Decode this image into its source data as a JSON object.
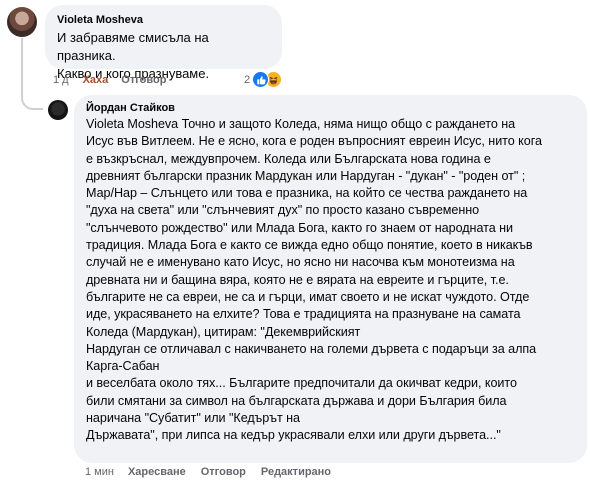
{
  "comments": [
    {
      "author": "Violeta Mosheva",
      "lines": [
        "И забравяме смисъла на празника.",
        "Какво и кого празнуваме."
      ],
      "time": "1 д",
      "like_label": "Хаха",
      "reply_label": "Отговор",
      "reaction_count": "2"
    },
    {
      "author": "Йордан Стайков",
      "lines": [
        "Violeta Mosheva Точно и защото Коледа, няма нищо общо с раждането на",
        "Исус във Витлеем. Не е ясно, кога е роден въпросният евреин Исус, нито кога",
        "е възкръснал, междувпрочем. Коледа или Българската нова година е",
        "древният български празник Мардукан или Нардуган - \"дукан\" - \"роден от\" ;",
        "Мар/Нар – Слънцето или това е празника, на който се чества раждането на",
        "\"духа на света\" или \"слънчевият дух\" по просто казано съвременно",
        "\"слънчевото рождество\" или Млада Бога, както го знаем от народната ни",
        "традиция. Млада Бога е както се вижда едно общо понятие, което в никакъв",
        "случай не е именувано като Исус, но ясно ни насочва към монотеизма на",
        "древната ни и бащина вяра, която не е вярата на евреите и гърците, т.е.",
        "българите не са евреи, не са и гърци, имат своето и не искат чуждото. Отде",
        "иде, украсяването на елхите? Това е традицията на празнуване на самата",
        "Коледа (Мардукан), цитирам: \"Декемврийският",
        "Нардуган се отличавал с накичването на големи дървета с подаръци за алпа",
        "Карга-Сабан",
        "и веселбата около тях... Българите предпочитали да окичват кедри, които",
        "били смятани за символ на българската държава и дори България била",
        "наричана \"Субатит\" или \"Кедърът на",
        "Държавата\", при липса на кедър украсявали елхи или други дървета...\""
      ],
      "time": "1 мин",
      "like_label": "Харесване",
      "reply_label": "Отговор",
      "edit_label": "Редактирано"
    }
  ],
  "icons": {
    "reaction_like": "thumbs-up-icon",
    "reaction_haha": "laughing-face-icon"
  },
  "colors": {
    "bubble_bg": "#f0f2f5",
    "meta_text": "#65676b",
    "haha_active": "#a0522d",
    "like_blue": "#1877f2",
    "haha_yellow": "#f7b125"
  }
}
